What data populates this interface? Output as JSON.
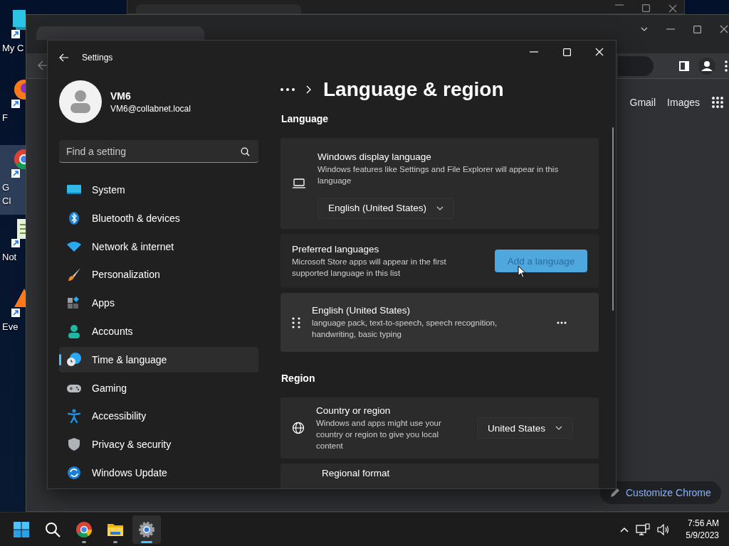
{
  "desktop": {
    "icons": [
      {
        "kind": "computer",
        "lines": [
          "My C"
        ],
        "selected": false
      },
      {
        "kind": "firefox",
        "lines": [
          "F"
        ],
        "selected": false
      },
      {
        "kind": "chrome",
        "lines": [
          "G",
          "Cl"
        ],
        "selected": true
      },
      {
        "kind": "notepad",
        "lines": [
          "Not"
        ],
        "selected": false
      },
      {
        "kind": "event",
        "lines": [
          "Eve"
        ],
        "selected": false
      }
    ]
  },
  "browser": {
    "links": [
      "Gmail",
      "Images"
    ],
    "customize_button": "Customize Chrome"
  },
  "settings": {
    "title": "Settings",
    "user": {
      "name": "VM6",
      "email": "VM6@collabnet.local"
    },
    "search": {
      "placeholder": "Find a setting"
    },
    "nav": [
      {
        "kind": "system",
        "label": "System",
        "selected": false
      },
      {
        "kind": "bluetooth",
        "label": "Bluetooth & devices",
        "selected": false
      },
      {
        "kind": "network",
        "label": "Network & internet",
        "selected": false
      },
      {
        "kind": "personalization",
        "label": "Personalization",
        "selected": false
      },
      {
        "kind": "apps",
        "label": "Apps",
        "selected": false
      },
      {
        "kind": "accounts",
        "label": "Accounts",
        "selected": false
      },
      {
        "kind": "time",
        "label": "Time & language",
        "selected": true
      },
      {
        "kind": "gaming",
        "label": "Gaming",
        "selected": false
      },
      {
        "kind": "accessibility",
        "label": "Accessibility",
        "selected": false
      },
      {
        "kind": "privacy",
        "label": "Privacy & security",
        "selected": false
      },
      {
        "kind": "update",
        "label": "Windows Update",
        "selected": false
      }
    ],
    "page_title": "Language & region",
    "sections": [
      {
        "heading": "Language",
        "cards": [
          {
            "kind": "display-language",
            "title": "Windows display language",
            "description": "Windows features like Settings and File Explorer will appear in this language",
            "value": "English (United States)"
          },
          {
            "kind": "preferred",
            "title": "Preferred languages",
            "description": "Microsoft Store apps will appear in the first supported language in this list",
            "button": "Add a language"
          },
          {
            "kind": "language-item",
            "title": "English (United States)",
            "description": "language pack, text-to-speech, speech recognition, handwriting, basic typing"
          }
        ]
      },
      {
        "heading": "Region",
        "cards": [
          {
            "kind": "country",
            "title": "Country or region",
            "description": "Windows and apps might use your country or region to give you local content",
            "value": "United States"
          },
          {
            "kind": "partial",
            "title": "Regional format"
          }
        ]
      }
    ]
  },
  "taskbar": {
    "apps": [
      {
        "kind": "start",
        "running": false,
        "selected": false
      },
      {
        "kind": "search",
        "running": false,
        "selected": false
      },
      {
        "kind": "chrome",
        "running": true,
        "selected": false
      },
      {
        "kind": "explorer",
        "running": true,
        "selected": false
      },
      {
        "kind": "settings",
        "running": true,
        "selected": true
      }
    ],
    "clock": {
      "time": "7:56 AM",
      "date": "5/9/2023"
    }
  }
}
